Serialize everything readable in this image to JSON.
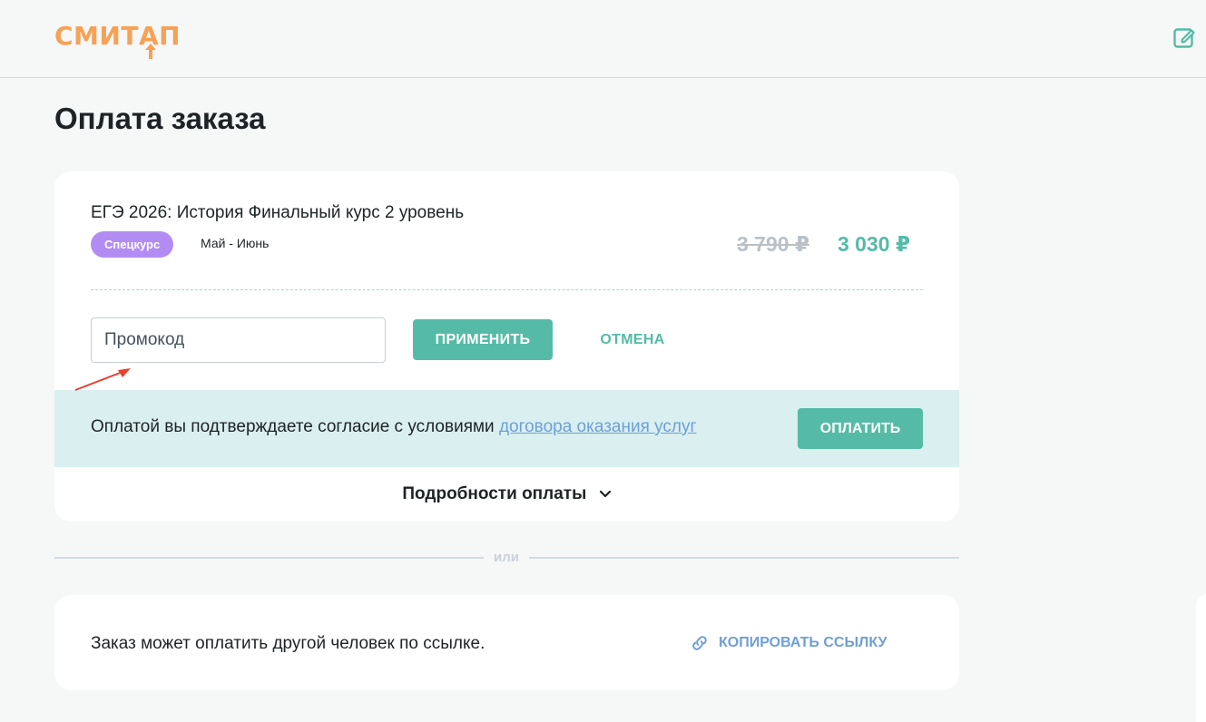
{
  "header": {
    "logo": {
      "part1": "СМИТ",
      "part2": "А",
      "part3": "П"
    },
    "edit_icon": "edit-icon"
  },
  "page": {
    "title": "Оплата заказа"
  },
  "order": {
    "course_title": "ЕГЭ 2026: История Финальный курс 2 уровень",
    "badge": "Спецкурс",
    "dates": "Май - Июнь",
    "old_price": "3 790 ₽",
    "new_price": "3 030 ₽",
    "promo": {
      "placeholder": "Промокод",
      "apply_label": "ПРИМЕНИТЬ",
      "cancel_label": "ОТМЕНА"
    },
    "consent": {
      "text": "Оплатой вы подтверждаете согласие с условиями ",
      "link": "договора оказания услуг"
    },
    "pay_label": "ОПЛАТИТЬ",
    "details_label": "Подробности оплаты"
  },
  "separator": {
    "text": "или"
  },
  "share": {
    "text": "Заказ может оплатить другой человек по ссылке.",
    "copy_label": "КОПИРОВАТЬ ССЫЛКУ"
  },
  "colors": {
    "accent": "#55bba6",
    "logo": "#f7a155",
    "badge": "#b38cf3",
    "link": "#6f9fd8",
    "band": "#d9eff0"
  }
}
